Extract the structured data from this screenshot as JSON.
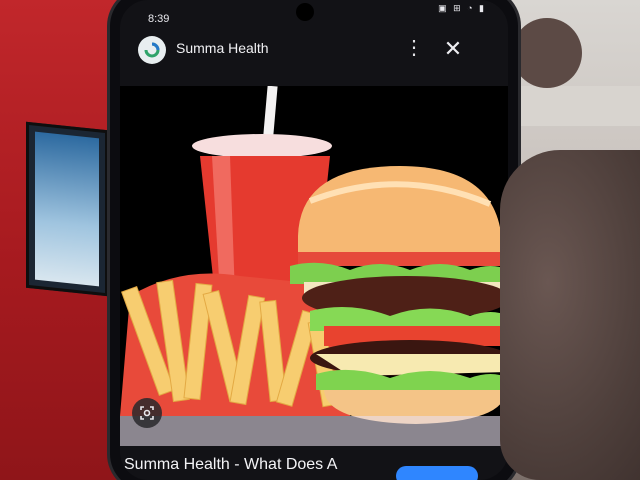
{
  "status_bar": {
    "time": "8:39",
    "icons_text": "▣ ⊞ ◔ ▮"
  },
  "header": {
    "title": "Summa Health",
    "menu_icon": "more-vert-icon",
    "close_icon": "close-icon",
    "logo_icon": "site-logo-icon"
  },
  "photo": {
    "subject": "fast-food-burger-fries-soda-image",
    "lens_icon": "lens-search-icon"
  },
  "caption": {
    "text": "Summa Health - What Does A"
  },
  "colors": {
    "wall": "#b61d22",
    "phone_screen": "#121216",
    "accent_pill": "#2f86ff"
  }
}
